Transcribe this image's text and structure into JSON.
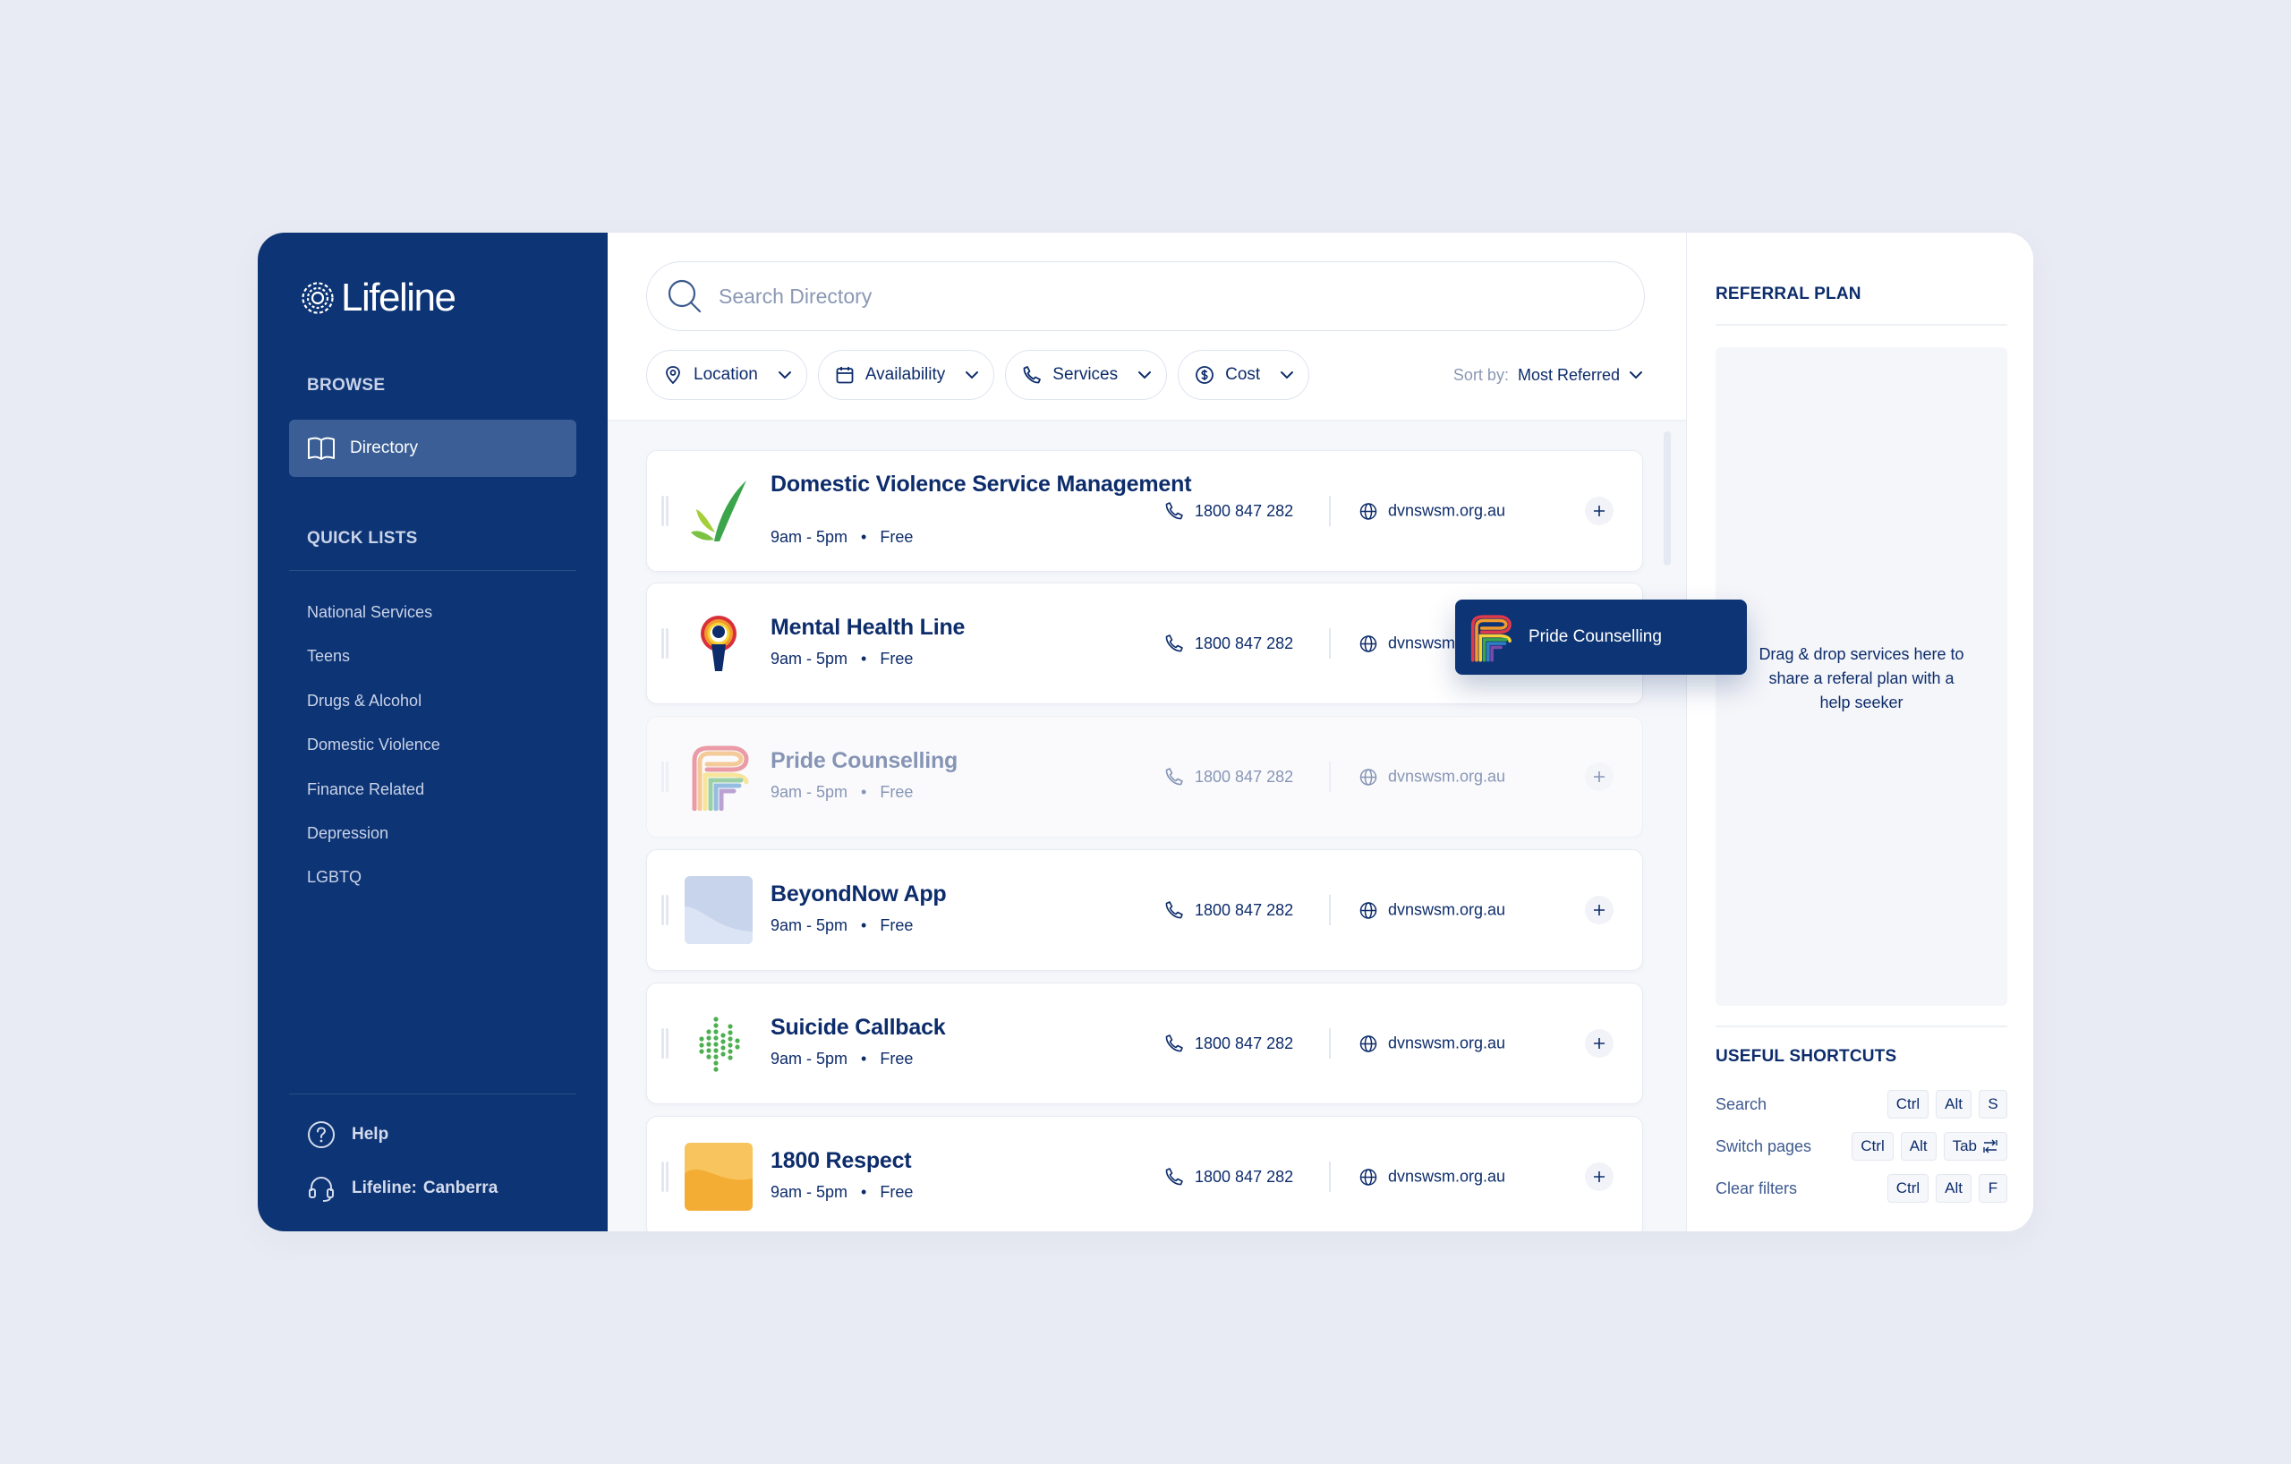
{
  "brand": {
    "name": "Lifeline"
  },
  "sidebar": {
    "browse_label": "BROWSE",
    "nav": [
      {
        "label": "Directory",
        "icon": "book-icon",
        "active": true
      }
    ],
    "quick_lists_label": "QUICK LISTS",
    "quick_lists": [
      "National Services",
      "Teens",
      "Drugs & Alcohol",
      "Domestic Violence",
      "Finance Related",
      "Depression",
      "LGBTQ"
    ],
    "help_label": "Help",
    "location_prefix": "Lifeline:",
    "location_value": "Canberra"
  },
  "search": {
    "placeholder": "Search Directory"
  },
  "filters": [
    {
      "label": "Location",
      "icon": "pin-icon"
    },
    {
      "label": "Availability",
      "icon": "calendar-icon"
    },
    {
      "label": "Services",
      "icon": "phone-icon"
    },
    {
      "label": "Cost",
      "icon": "dollar-icon"
    }
  ],
  "sort": {
    "label": "Sort by:",
    "value": "Most Referred"
  },
  "services": [
    {
      "title": "Domestic Violence Service Management",
      "hours": "9am - 5pm",
      "cost": "Free",
      "phone": "1800 847 282",
      "website": "dvnswsm.org.au",
      "logo": "leaf-logo",
      "dragging": false
    },
    {
      "title": "Mental Health Line",
      "hours": "9am - 5pm",
      "cost": "Free",
      "phone": "1800 847 282",
      "website": "dvnswsm.org.au",
      "logo": "person-rainbow-logo",
      "dragging": false
    },
    {
      "title": "Pride Counselling",
      "hours": "9am - 5pm",
      "cost": "Free",
      "phone": "1800 847 282",
      "website": "dvnswsm.org.au",
      "logo": "rainbow-p-logo",
      "dragging": true
    },
    {
      "title": "BeyondNow App",
      "hours": "9am - 5pm",
      "cost": "Free",
      "phone": "1800 847 282",
      "website": "dvnswsm.org.au",
      "logo": "blue-wave-logo",
      "dragging": false
    },
    {
      "title": "Suicide Callback",
      "hours": "9am - 5pm",
      "cost": "Free",
      "phone": "1800 847 282",
      "website": "dvnswsm.org.au",
      "logo": "green-dots-logo",
      "dragging": false
    },
    {
      "title": "1800 Respect",
      "hours": "9am - 5pm",
      "cost": "Free",
      "phone": "1800 847 282",
      "website": "dvnswsm.org.au",
      "logo": "orange-wave-logo",
      "dragging": false
    }
  ],
  "drag_chip": {
    "label": "Pride Counselling"
  },
  "referral_plan": {
    "title": "REFERRAL PLAN",
    "dropzone_text": "Drag & drop services here to share a referal plan with a help seeker"
  },
  "shortcuts": {
    "title": "USEFUL SHORTCUTS",
    "items": [
      {
        "label": "Search",
        "keys": [
          "Ctrl",
          "Alt",
          "S"
        ]
      },
      {
        "label": "Switch pages",
        "keys": [
          "Ctrl",
          "Alt",
          "Tab"
        ]
      },
      {
        "label": "Clear filters",
        "keys": [
          "Ctrl",
          "Alt",
          "F"
        ]
      }
    ]
  },
  "colors": {
    "sidebar": "#0d3475",
    "text": "#0d2c6b",
    "background": "#e8ebf3"
  }
}
